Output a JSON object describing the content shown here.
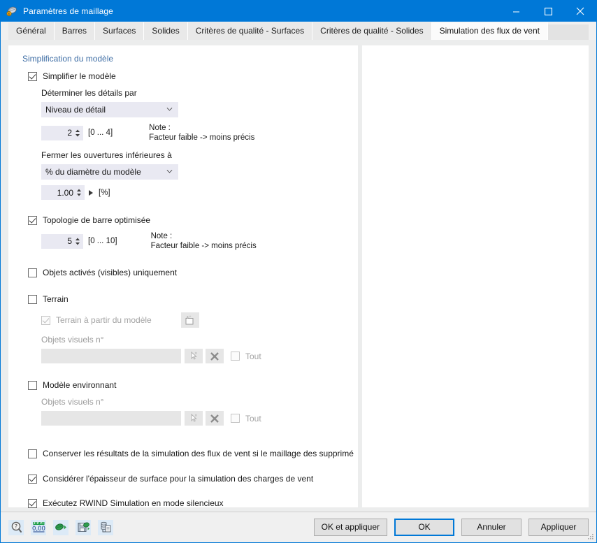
{
  "window": {
    "title": "Paramètres de maillage",
    "icon": "mesh-settings-icon",
    "minimize": "−",
    "maximize": "▢",
    "close": "✕"
  },
  "tabs": [
    {
      "label": "Général",
      "active": false
    },
    {
      "label": "Barres",
      "active": false
    },
    {
      "label": "Surfaces",
      "active": false
    },
    {
      "label": "Solides",
      "active": false
    },
    {
      "label": "Critères de qualité - Surfaces",
      "active": false
    },
    {
      "label": "Critères de qualité - Solides",
      "active": false
    },
    {
      "label": "Simulation des flux de vent",
      "active": true
    }
  ],
  "panel": {
    "section_title": "Simplification du modèle",
    "simplify": {
      "label": "Simplifier le modèle",
      "checked": true
    },
    "determine_details": {
      "label": "Déterminer les détails par",
      "combo_value": "Niveau de détail",
      "spin_value": "2",
      "range": "[0 ... 4]",
      "note_line1": "Note :",
      "note_line2": "Facteur faible -> moins précis"
    },
    "close_openings": {
      "label": "Fermer les ouvertures inférieures à",
      "combo_value": "% du diamètre du modèle",
      "spin_value": "1.00",
      "unit": "[%]"
    },
    "optimized_topology": {
      "label": "Topologie de barre optimisée",
      "checked": true,
      "spin_value": "5",
      "range": "[0 ... 10]",
      "note_line1": "Note :",
      "note_line2": "Facteur faible -> moins précis"
    },
    "active_objects_only": {
      "label": "Objets activés (visibles) uniquement",
      "checked": false
    },
    "terrain": {
      "label": "Terrain",
      "checked": false,
      "from_model_label": "Terrain à partir du modèle",
      "from_model_checked": true,
      "visual_objects_label": "Objets visuels n°",
      "visual_objects_value": "",
      "all_label": "Tout",
      "all_checked": false
    },
    "surrounding_model": {
      "label": "Modèle environnant",
      "checked": false,
      "visual_objects_label": "Objets visuels n°",
      "visual_objects_value": "",
      "all_label": "Tout",
      "all_checked": false
    },
    "keep_results": {
      "label": "Conserver les résultats de la simulation des flux de vent si le maillage des supprimé",
      "checked": false
    },
    "consider_thickness": {
      "label": "Considérer l'épaisseur de surface pour la simulation des charges de vent",
      "checked": true
    },
    "silent_mode": {
      "label": "Exécutez RWIND Simulation en mode silencieux",
      "checked": true
    }
  },
  "footer": {
    "tools": [
      {
        "name": "help-icon"
      },
      {
        "name": "units-icon",
        "text": "0,00"
      },
      {
        "name": "export-icon"
      },
      {
        "name": "save-settings-icon"
      },
      {
        "name": "copy-settings-icon"
      }
    ],
    "buttons": [
      {
        "label": "OK et appliquer",
        "default": false,
        "name": "ok-and-apply-button"
      },
      {
        "label": "OK",
        "default": true,
        "name": "ok-button"
      },
      {
        "label": "Annuler",
        "default": false,
        "name": "cancel-button"
      },
      {
        "label": "Appliquer",
        "default": false,
        "name": "apply-button"
      }
    ]
  },
  "colors": {
    "accent": "#0078d7",
    "section_title": "#3f6ea5",
    "field_bg": "#e9e9f2",
    "disabled_bg": "#e6e6e6"
  }
}
